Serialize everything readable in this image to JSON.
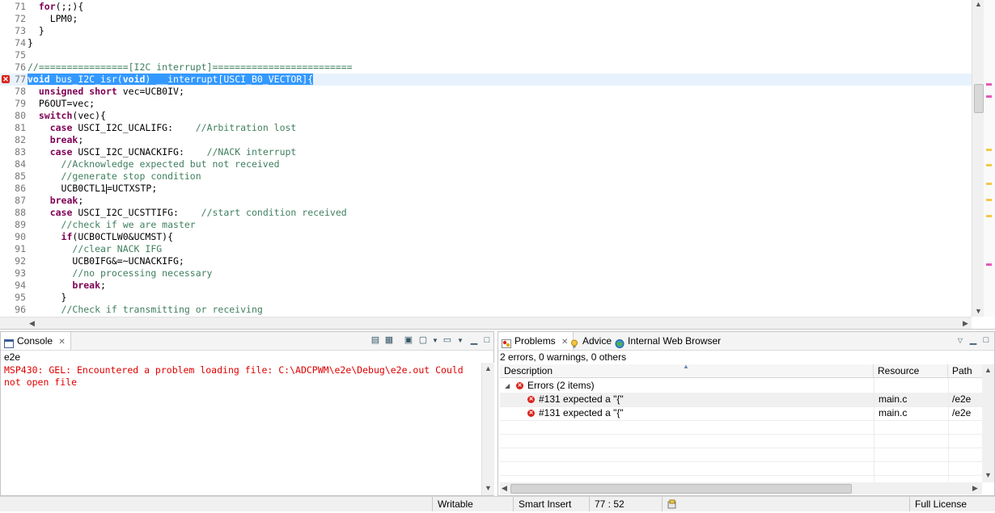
{
  "editor": {
    "lines": [
      {
        "no": "71",
        "html": "  <span class='kw'>for</span>(;;){"
      },
      {
        "no": "72",
        "html": "    LPM0;"
      },
      {
        "no": "73",
        "html": "  }"
      },
      {
        "no": "74",
        "html": "}"
      },
      {
        "no": "75",
        "html": ""
      },
      {
        "no": "76",
        "html": "<span class='cm'>//================[I2C interrupt]=========================</span>"
      },
      {
        "no": "77",
        "html": "<span class='sel kw'>void</span><span class='sel'> bus_I2C_isr(</span><span class='sel kw'>void</span><span class='sel'>) __interrupt[USCI_B0_VECTOR]{</span>",
        "current": true,
        "error": true
      },
      {
        "no": "78",
        "html": "  <span class='kw'>unsigned short</span> vec=UCB0IV;"
      },
      {
        "no": "79",
        "html": "  P6OUT=vec;"
      },
      {
        "no": "80",
        "html": "  <span class='kw'>switch</span>(vec){"
      },
      {
        "no": "81",
        "html": "    <span class='kw'>case</span> USCI_I2C_UCALIFG:    <span class='cm'>//Arbitration lost</span>"
      },
      {
        "no": "82",
        "html": "    <span class='kw'>break</span>;"
      },
      {
        "no": "83",
        "html": "    <span class='kw'>case</span> USCI_I2C_UCNACKIFG:    <span class='cm'>//NACK interrupt</span>"
      },
      {
        "no": "84",
        "html": "      <span class='cm'>//Acknowledge expected but not received</span>"
      },
      {
        "no": "85",
        "html": "      <span class='cm'>//generate stop condition</span>"
      },
      {
        "no": "86",
        "html": "      UCB0CTL1<span class='caret'></span>=UCTXSTP;"
      },
      {
        "no": "87",
        "html": "    <span class='kw'>break</span>;"
      },
      {
        "no": "88",
        "html": "    <span class='kw'>case</span> USCI_I2C_UCSTTIFG:    <span class='cm'>//start condition received</span>"
      },
      {
        "no": "89",
        "html": "      <span class='cm'>//check if we are master</span>"
      },
      {
        "no": "90",
        "html": "      <span class='kw'>if</span>(UCB0CTLW0&amp;UCMST){"
      },
      {
        "no": "91",
        "html": "        <span class='cm'>//clear NACK IFG</span>"
      },
      {
        "no": "92",
        "html": "        UCB0IFG&amp;=~UCNACKIFG;"
      },
      {
        "no": "93",
        "html": "        <span class='cm'>//no processing necessary</span>"
      },
      {
        "no": "94",
        "html": "        <span class='kw'>break</span>;"
      },
      {
        "no": "95",
        "html": "      }"
      },
      {
        "no": "96",
        "html": "      <span class='cm'>//Check if transmitting or receiving</span>"
      }
    ]
  },
  "console": {
    "tab_label": "Console",
    "name": "e2e",
    "output": "MSP430: GEL: Encountered a problem loading file: C:\\ADCPWM\\e2e\\Debug\\e2e.out Could not open file"
  },
  "problems": {
    "tabs": [
      {
        "label": "Problems"
      },
      {
        "label": "Advice"
      },
      {
        "label": "Internal Web Browser"
      }
    ],
    "summary": "2 errors, 0 warnings, 0 others",
    "columns": [
      "Description",
      "Resource",
      "Path"
    ],
    "group": "Errors (2 items)",
    "rows": [
      {
        "description": "#131 expected a \"{\"",
        "resource": "main.c",
        "path": "/e2e"
      },
      {
        "description": "#131 expected a \"{\"",
        "resource": "main.c",
        "path": "/e2e"
      }
    ]
  },
  "statusbar": {
    "writable": "Writable",
    "insert_mode": "Smart Insert",
    "position": "77 : 52",
    "license": "Full License"
  },
  "colors": {
    "keyword": "#7f0055",
    "comment": "#3f7f5f",
    "selection": "#3399ff",
    "error": "#d9251c",
    "console_error_text": "#e00000"
  }
}
